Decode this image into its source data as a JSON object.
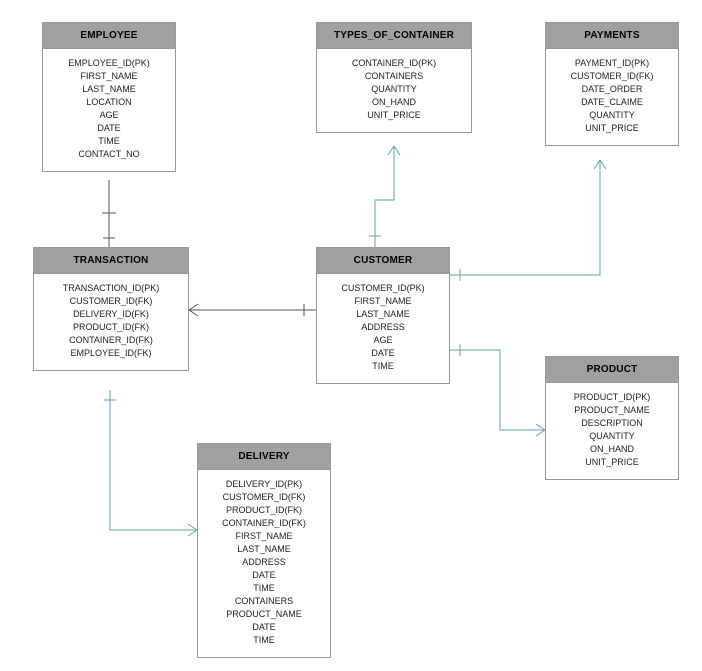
{
  "entities": {
    "employee": {
      "title": "EMPLOYEE",
      "attrs": [
        "EMPLOYEE_ID(PK)",
        "FIRST_NAME",
        "LAST_NAME",
        "LOCATION",
        "AGE",
        "DATE",
        "TIME",
        "CONTACT_NO"
      ]
    },
    "types_of_container": {
      "title": "TYPES_OF_CONTAINER",
      "attrs": [
        "CONTAINER_ID(PK)",
        "CONTAINERS",
        "QUANTITY",
        "ON_HAND",
        "UNIT_PRICE"
      ]
    },
    "payments": {
      "title": "PAYMENTS",
      "attrs": [
        "PAYMENT_ID(PK)",
        "CUSTOMER_ID(FK)",
        "DATE_ORDER",
        "DATE_CLAIME",
        "QUANTITY",
        "UNIT_PRICE"
      ]
    },
    "transaction": {
      "title": "TRANSACTION",
      "attrs": [
        "TRANSACTION_ID(PK)",
        "CUSTOMER_ID(FK)",
        "DELIVERY_ID(FK)",
        "PRODUCT_ID(FK)",
        "CONTAINER_ID(FK)",
        "EMPLOYEE_ID(FK)"
      ]
    },
    "customer": {
      "title": "CUSTOMER",
      "attrs": [
        "CUSTOMER_ID(PK)",
        "FIRST_NAME",
        "LAST_NAME",
        "ADDRESS",
        "AGE",
        "DATE",
        "TIME"
      ]
    },
    "product": {
      "title": "PRODUCT",
      "attrs": [
        "PRODUCT_ID(PK)",
        "PRODUCT_NAME",
        "DESCRIPTION",
        "QUANTITY",
        "ON_HAND",
        "UNIT_PRICE"
      ]
    },
    "delivery": {
      "title": "DELIVERY",
      "attrs": [
        "DELIVERY_ID(PK)",
        "CUSTOMER_ID(FK)",
        "PRODUCT_ID(FK)",
        "CONTAINER_ID(FK)",
        "FIRST_NAME",
        "LAST_NAME",
        "ADDRESS",
        "DATE",
        "TIME",
        "CONTAINERS",
        "PRODUCT_NAME",
        "DATE",
        "TIME"
      ]
    }
  },
  "chart_data": {
    "type": "er-diagram",
    "entities": [
      {
        "name": "EMPLOYEE",
        "pk": [
          "EMPLOYEE_ID"
        ],
        "cols": [
          "EMPLOYEE_ID",
          "FIRST_NAME",
          "LAST_NAME",
          "LOCATION",
          "AGE",
          "DATE",
          "TIME",
          "CONTACT_NO"
        ]
      },
      {
        "name": "TYPES_OF_CONTAINER",
        "pk": [
          "CONTAINER_ID"
        ],
        "cols": [
          "CONTAINER_ID",
          "CONTAINERS",
          "QUANTITY",
          "ON_HAND",
          "UNIT_PRICE"
        ]
      },
      {
        "name": "PAYMENTS",
        "pk": [
          "PAYMENT_ID"
        ],
        "fk": [
          "CUSTOMER_ID"
        ],
        "cols": [
          "PAYMENT_ID",
          "CUSTOMER_ID",
          "DATE_ORDER",
          "DATE_CLAIME",
          "QUANTITY",
          "UNIT_PRICE"
        ]
      },
      {
        "name": "TRANSACTION",
        "pk": [
          "TRANSACTION_ID"
        ],
        "fk": [
          "CUSTOMER_ID",
          "DELIVERY_ID",
          "PRODUCT_ID",
          "CONTAINER_ID",
          "EMPLOYEE_ID"
        ],
        "cols": [
          "TRANSACTION_ID",
          "CUSTOMER_ID",
          "DELIVERY_ID",
          "PRODUCT_ID",
          "CONTAINER_ID",
          "EMPLOYEE_ID"
        ]
      },
      {
        "name": "CUSTOMER",
        "pk": [
          "CUSTOMER_ID"
        ],
        "cols": [
          "CUSTOMER_ID",
          "FIRST_NAME",
          "LAST_NAME",
          "ADDRESS",
          "AGE",
          "DATE",
          "TIME"
        ]
      },
      {
        "name": "PRODUCT",
        "pk": [
          "PRODUCT_ID"
        ],
        "cols": [
          "PRODUCT_ID",
          "PRODUCT_NAME",
          "DESCRIPTION",
          "QUANTITY",
          "ON_HAND",
          "UNIT_PRICE"
        ]
      },
      {
        "name": "DELIVERY",
        "pk": [
          "DELIVERY_ID"
        ],
        "fk": [
          "CUSTOMER_ID",
          "PRODUCT_ID",
          "CONTAINER_ID"
        ],
        "cols": [
          "DELIVERY_ID",
          "CUSTOMER_ID",
          "PRODUCT_ID",
          "CONTAINER_ID",
          "FIRST_NAME",
          "LAST_NAME",
          "ADDRESS",
          "DATE",
          "TIME",
          "CONTAINERS",
          "PRODUCT_NAME",
          "DATE",
          "TIME"
        ]
      }
    ],
    "relationships": [
      {
        "from": "EMPLOYEE",
        "to": "TRANSACTION"
      },
      {
        "from": "CUSTOMER",
        "to": "TRANSACTION"
      },
      {
        "from": "CUSTOMER",
        "to": "TYPES_OF_CONTAINER"
      },
      {
        "from": "CUSTOMER",
        "to": "PAYMENTS"
      },
      {
        "from": "CUSTOMER",
        "to": "PRODUCT"
      },
      {
        "from": "TRANSACTION",
        "to": "DELIVERY"
      }
    ]
  }
}
